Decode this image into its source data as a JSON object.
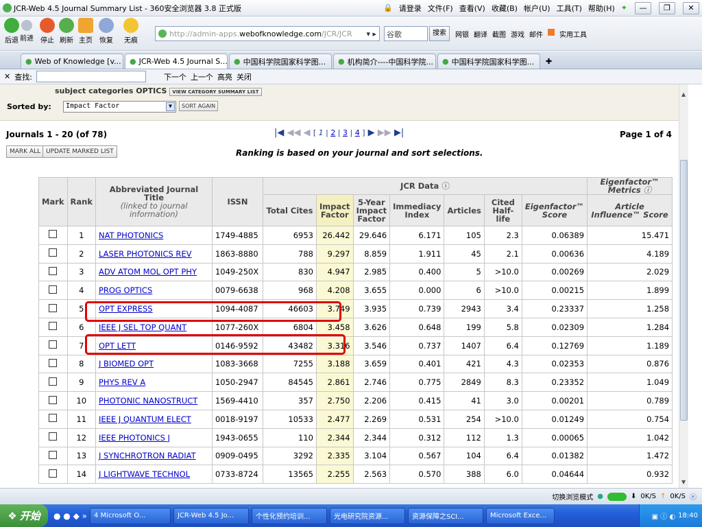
{
  "window": {
    "title": "JCR-Web 4.5 Journal Summary List - 360安全浏览器 3.8 正式版",
    "menus": [
      "请登录",
      "文件(F)",
      "查看(V)",
      "收藏(B)",
      "帐户(U)",
      "工具(T)",
      "帮助(H)"
    ]
  },
  "nav": {
    "buttons": [
      "后退",
      "前进",
      "停止",
      "刷新",
      "主页",
      "恢复",
      "无痕"
    ],
    "address": {
      "prefix": "http://admin-apps.",
      "domain": "webofknowledge.com",
      "suffix": "/JCR/JCR"
    },
    "search_placeholder": "谷歌",
    "search_button": "搜索",
    "tools": [
      "网银",
      "翻译",
      "截图",
      "游戏",
      "邮件",
      "",
      "实用工具"
    ]
  },
  "tabs": [
    {
      "label": "Web of Knowledge [v..."
    },
    {
      "label": "JCR-Web 4.5 Journal S..."
    },
    {
      "label": "中国科学院国家科学图..."
    },
    {
      "label": "机构简介----中国科学院..."
    },
    {
      "label": "中国科学院国家科学图..."
    }
  ],
  "findbar": {
    "label": "查找:",
    "next": "下一个",
    "prev": "上一个",
    "highlight": "高亮",
    "close": "关闭"
  },
  "sort": {
    "subject_label": "subject categories OPTICS",
    "view_summary": "VIEW CATEGORY SUMMARY LIST",
    "sorted_by_label": "Sorted by:",
    "sorted_by_value": "Impact Factor",
    "sort_again": "SORT AGAIN"
  },
  "list": {
    "range": "Journals 1 - 20 (of 78)",
    "pager_current": "1",
    "pager_pages": [
      "2",
      "3",
      "4"
    ],
    "page_info": "Page 1 of 4",
    "mark_all": "MARK ALL",
    "update_marked": "UPDATE MARKED LIST",
    "ranking_note": "Ranking is based on your journal and sort selections."
  },
  "table": {
    "headers": {
      "mark": "Mark",
      "rank": "Rank",
      "title": "Abbreviated Journal Title",
      "title_sub": "(linked to journal information)",
      "issn": "ISSN",
      "jcr": "JCR Data",
      "total_cites": "Total Cites",
      "if": "Impact Factor",
      "if5": "5-Year Impact Factor",
      "immediacy": "Immediacy Index",
      "articles": "Articles",
      "halflife": "Cited Half-life",
      "eigen_group": "Eigenfactor™ Metrics",
      "eigen": "Eigenfactor™ Score",
      "ai": "Article Influence™ Score"
    },
    "rows": [
      {
        "rank": "1",
        "title": "NAT PHOTONICS",
        "issn": "1749-4885",
        "cites": "6953",
        "if": "26.442",
        "if5": "29.646",
        "imm": "6.171",
        "art": "105",
        "hl": "2.3",
        "eig": "0.06389",
        "ai": "15.471"
      },
      {
        "rank": "2",
        "title": "LASER PHOTONICS REV",
        "issn": "1863-8880",
        "cites": "788",
        "if": "9.297",
        "if5": "8.859",
        "imm": "1.911",
        "art": "45",
        "hl": "2.1",
        "eig": "0.00636",
        "ai": "4.189"
      },
      {
        "rank": "3",
        "title": "ADV ATOM MOL OPT PHY",
        "issn": "1049-250X",
        "cites": "830",
        "if": "4.947",
        "if5": "2.985",
        "imm": "0.400",
        "art": "5",
        "hl": ">10.0",
        "eig": "0.00269",
        "ai": "2.029"
      },
      {
        "rank": "4",
        "title": "PROG OPTICS",
        "issn": "0079-6638",
        "cites": "968",
        "if": "4.208",
        "if5": "3.655",
        "imm": "0.000",
        "art": "6",
        "hl": ">10.0",
        "eig": "0.00215",
        "ai": "1.899"
      },
      {
        "rank": "5",
        "title": "OPT EXPRESS",
        "issn": "1094-4087",
        "cites": "46603",
        "if": "3.749",
        "if5": "3.935",
        "imm": "0.739",
        "art": "2943",
        "hl": "3.4",
        "eig": "0.23337",
        "ai": "1.258"
      },
      {
        "rank": "6",
        "title": "IEEE J SEL TOP QUANT",
        "issn": "1077-260X",
        "cites": "6804",
        "if": "3.458",
        "if5": "3.626",
        "imm": "0.648",
        "art": "199",
        "hl": "5.8",
        "eig": "0.02309",
        "ai": "1.284"
      },
      {
        "rank": "7",
        "title": "OPT LETT",
        "issn": "0146-9592",
        "cites": "43482",
        "if": "3.316",
        "if5": "3.546",
        "imm": "0.737",
        "art": "1407",
        "hl": "6.4",
        "eig": "0.12769",
        "ai": "1.189"
      },
      {
        "rank": "8",
        "title": "J BIOMED OPT",
        "issn": "1083-3668",
        "cites": "7255",
        "if": "3.188",
        "if5": "3.659",
        "imm": "0.401",
        "art": "421",
        "hl": "4.3",
        "eig": "0.02353",
        "ai": "0.876"
      },
      {
        "rank": "9",
        "title": "PHYS REV A",
        "issn": "1050-2947",
        "cites": "84545",
        "if": "2.861",
        "if5": "2.746",
        "imm": "0.775",
        "art": "2849",
        "hl": "8.3",
        "eig": "0.23352",
        "ai": "1.049"
      },
      {
        "rank": "10",
        "title": "PHOTONIC NANOSTRUCT",
        "issn": "1569-4410",
        "cites": "357",
        "if": "2.750",
        "if5": "2.206",
        "imm": "0.415",
        "art": "41",
        "hl": "3.0",
        "eig": "0.00201",
        "ai": "0.789"
      },
      {
        "rank": "11",
        "title": "IEEE J QUANTUM ELECT",
        "issn": "0018-9197",
        "cites": "10533",
        "if": "2.477",
        "if5": "2.269",
        "imm": "0.531",
        "art": "254",
        "hl": ">10.0",
        "eig": "0.01249",
        "ai": "0.754"
      },
      {
        "rank": "12",
        "title": "IEEE PHOTONICS J",
        "issn": "1943-0655",
        "cites": "110",
        "if": "2.344",
        "if5": "2.344",
        "imm": "0.312",
        "art": "112",
        "hl": "1.3",
        "eig": "0.00065",
        "ai": "1.042"
      },
      {
        "rank": "13",
        "title": "J SYNCHROTRON RADIAT",
        "issn": "0909-0495",
        "cites": "3292",
        "if": "2.335",
        "if5": "3.104",
        "imm": "0.567",
        "art": "104",
        "hl": "6.4",
        "eig": "0.01382",
        "ai": "1.472"
      },
      {
        "rank": "14",
        "title": "J LIGHTWAVE TECHNOL",
        "issn": "0733-8724",
        "cites": "13565",
        "if": "2.255",
        "if5": "2.563",
        "imm": "0.570",
        "art": "388",
        "hl": "6.0",
        "eig": "0.04644",
        "ai": "0.932"
      }
    ]
  },
  "status": {
    "mode": "切换浏览模式",
    "net_down": "0K/S",
    "net_up": "0K/S"
  },
  "taskbar": {
    "start": "开始",
    "tasks": [
      "4 Microsoft O...",
      "JCR-Web 4.5 Jo...",
      "个性化预约培训...",
      "光电研究院资源...",
      "资源保障之SCI...",
      "Microsoft Exce..."
    ],
    "time": "18:40"
  },
  "colors": {
    "highlight": "#e00000",
    "if_column": "#fbf8d4",
    "link": "#0000cc"
  }
}
